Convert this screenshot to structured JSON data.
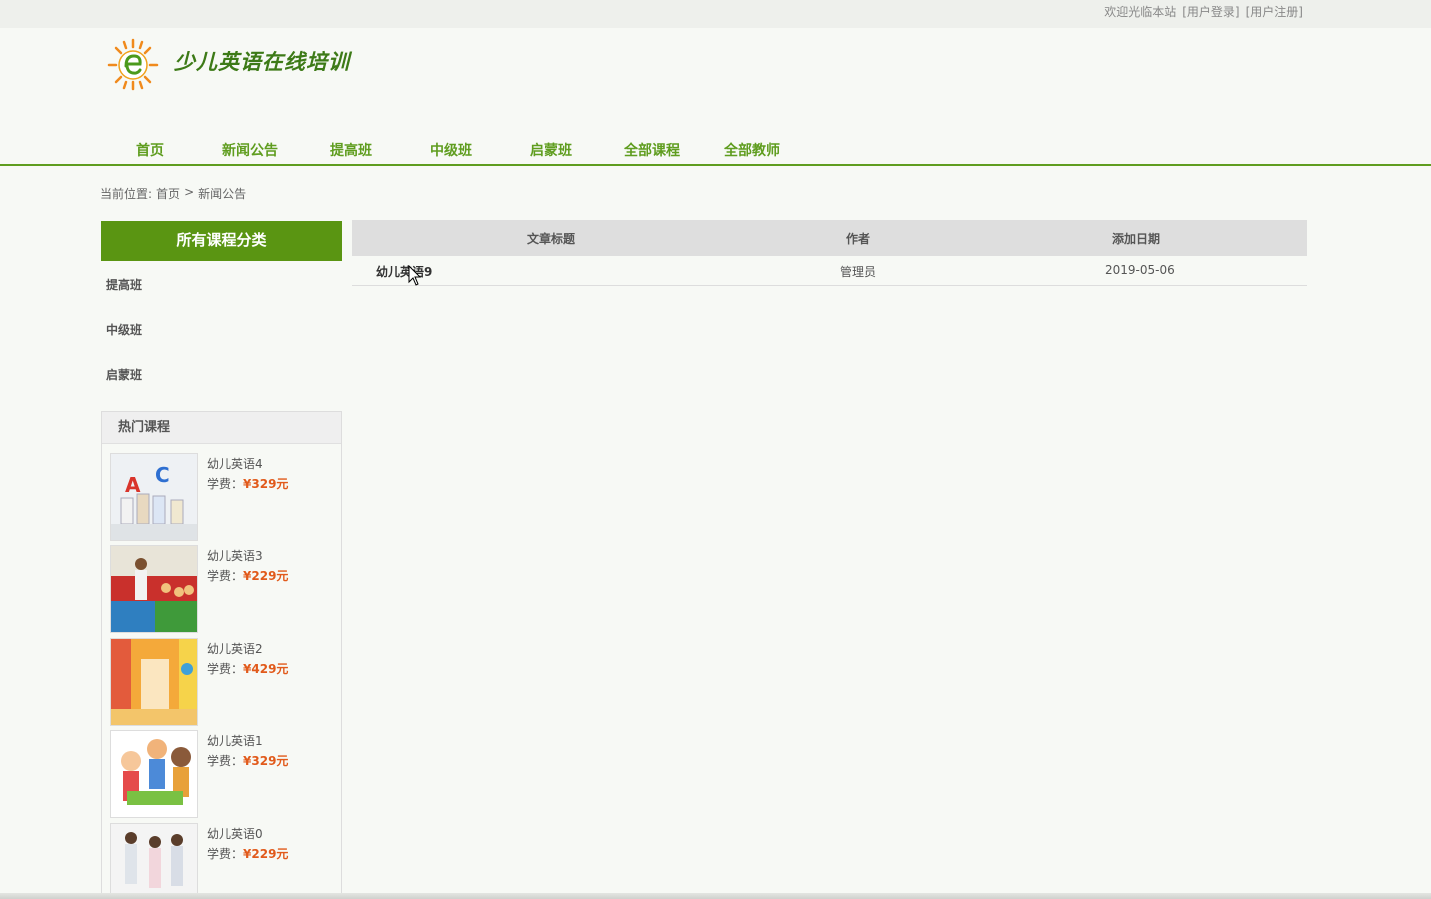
{
  "topbar": {
    "welcome": "欢迎光临本站",
    "login": "[用户登录]",
    "register": "[用户注册]"
  },
  "site": {
    "title": "少儿英语在线培训",
    "logo_icon": "sun-e-logo-icon"
  },
  "nav": {
    "items": [
      "首页",
      "新闻公告",
      "提高班",
      "中级班",
      "启蒙班",
      "全部课程",
      "全部教师"
    ],
    "color": "#5f9d1f"
  },
  "breadcrumb": {
    "prefix": "当前位置:",
    "home": "首页",
    "separator": ">",
    "current": "新闻公告"
  },
  "sidebar": {
    "heading": "所有课程分类",
    "categories": [
      "提高班",
      "中级班",
      "启蒙班"
    ],
    "accent": "#5a9512"
  },
  "hot_courses": {
    "heading": "热门课程",
    "price_label": "学费：",
    "items": [
      {
        "name": "幼儿英语4",
        "price": "¥329元",
        "image": "abc-children-photo"
      },
      {
        "name": "幼儿英语3",
        "price": "¥229元",
        "image": "classroom-teacher-photo"
      },
      {
        "name": "幼儿英语2",
        "price": "¥429元",
        "image": "colorful-hallway-photo"
      },
      {
        "name": "幼儿英语1",
        "price": "¥329元",
        "image": "cartoon-kids-illustration"
      },
      {
        "name": "幼儿英语0",
        "price": "¥229元",
        "image": "kids-standing-photo"
      }
    ],
    "price_color": "#e15a1b"
  },
  "table": {
    "headers": [
      "文章标题",
      "作者",
      "添加日期"
    ],
    "rows": [
      {
        "title": "幼儿英语9",
        "author": "管理员",
        "date": "2019-05-06"
      }
    ]
  }
}
